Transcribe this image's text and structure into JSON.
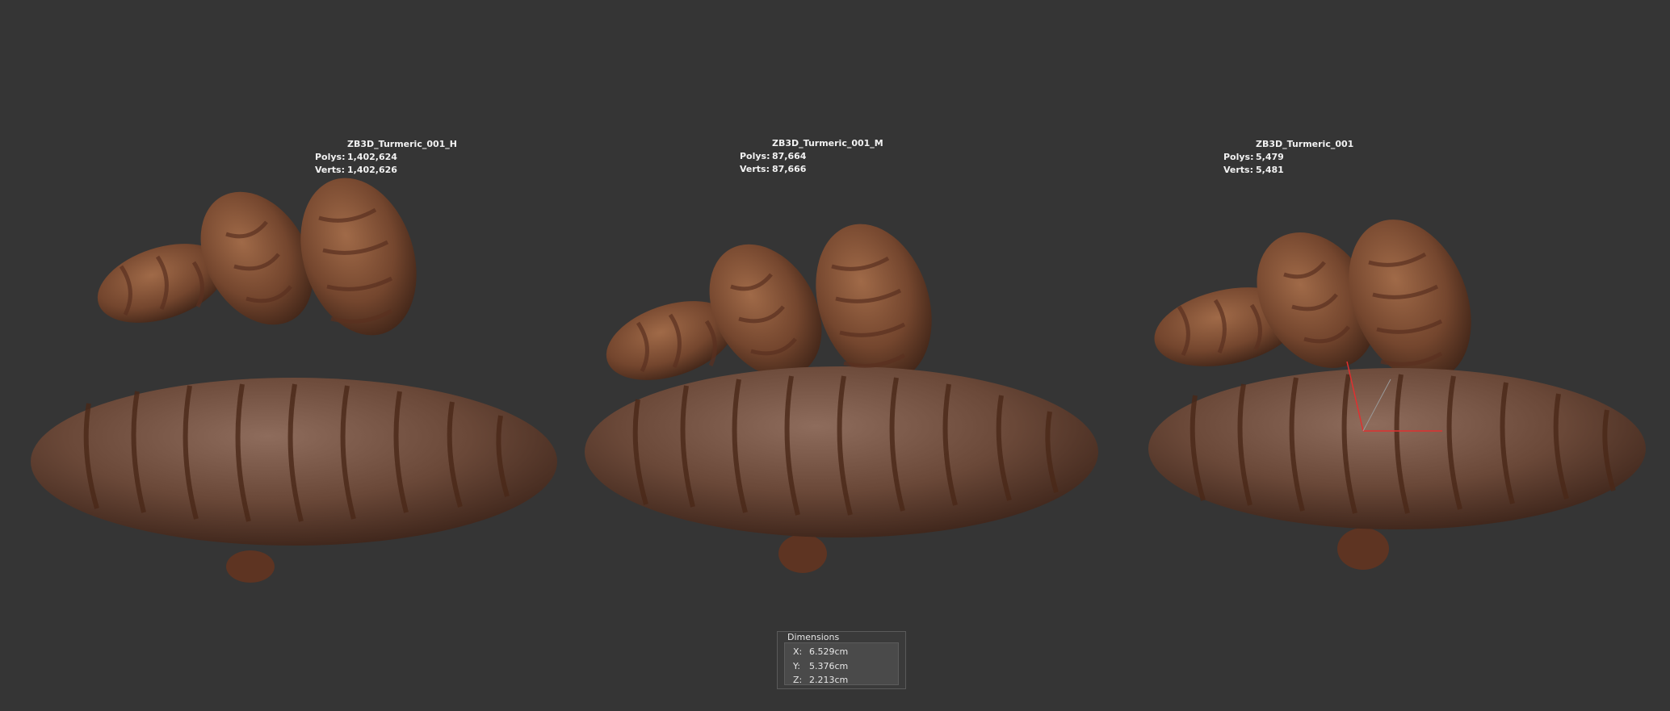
{
  "models": [
    {
      "name": "ZB3D_Turmeric_001_H",
      "polys_label": "Polys:",
      "polys": "1,402,624",
      "verts_label": "Verts:",
      "verts": "1,402,626"
    },
    {
      "name": "ZB3D_Turmeric_001_M",
      "polys_label": "Polys:",
      "polys": "87,664",
      "verts_label": "Verts:",
      "verts": "87,666"
    },
    {
      "name": "ZB3D_Turmeric_001",
      "polys_label": "Polys:",
      "polys": "5,479",
      "verts_label": "Verts:",
      "verts": "5,481"
    }
  ],
  "dimensions": {
    "title": "Dimensions",
    "x_label": "X:",
    "x": "6.529cm",
    "y_label": "Y:",
    "y": "5.376cm",
    "z_label": "Z:",
    "z": "2.213cm"
  },
  "colors": {
    "background": "#353535",
    "skin": "#7a5a4a",
    "skin_dark": "#4a2a1c",
    "skin_orange": "#9a5a32",
    "gizmo": "#e03030"
  }
}
